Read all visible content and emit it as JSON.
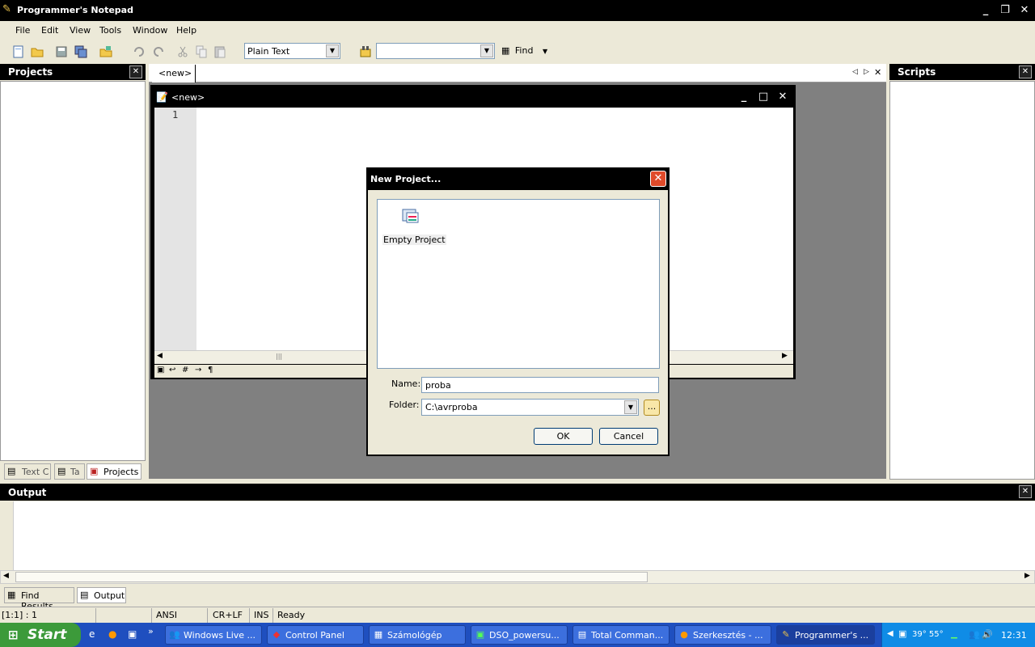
{
  "window": {
    "title": "Programmer's Notepad"
  },
  "menu": [
    "File",
    "Edit",
    "View",
    "Tools",
    "Window",
    "Help"
  ],
  "toolbar": {
    "scheme_value": "Plain Text",
    "search_value": "",
    "find_label": "Find"
  },
  "projects_pane": {
    "title": "Projects",
    "tabs": [
      "Text C",
      "Ta",
      "Projects"
    ]
  },
  "scripts_pane": {
    "title": "Scripts"
  },
  "doc_tab": {
    "label": "<new>"
  },
  "child_window": {
    "title": "<new>",
    "line_number": "1"
  },
  "dialog": {
    "title": "New Project...",
    "template_label": "Empty Project",
    "name_label": "Name:",
    "name_value": "proba",
    "folder_label": "Folder:",
    "folder_value": "C:\\avrproba",
    "browse_label": "...",
    "ok_label": "OK",
    "cancel_label": "Cancel"
  },
  "output_pane": {
    "title": "Output",
    "tabs": [
      "Find Results",
      "Output"
    ]
  },
  "statusbar": {
    "position": "[1:1] : 1",
    "encoding": "ANSI",
    "line_endings": "CR+LF",
    "insert_mode": "INS",
    "state": "Ready"
  },
  "taskbar": {
    "start_label": "Start",
    "tasks": [
      "Windows Live ...",
      "Control Panel",
      "Számológép",
      "DSO_powersu...",
      "Total Comman...",
      "Szerkesztés - ...",
      "Programmer's ..."
    ],
    "temp": "39° 55°",
    "clock": "12:31"
  }
}
